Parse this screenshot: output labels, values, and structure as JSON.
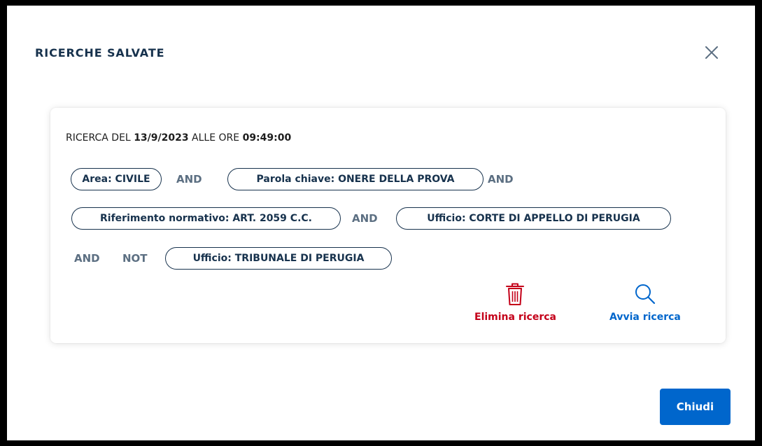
{
  "modal": {
    "title": "RICERCHE SALVATE",
    "close_icon": "close-icon"
  },
  "search": {
    "prefix": "RICERCA DEL ",
    "date": "13/9/2023",
    "middle": " ALLE ORE ",
    "time": "09:49:00",
    "criteria": [
      "Area: CIVILE",
      "Parola chiave: ONERE DELLA PROVA",
      "Riferimento normativo: ART. 2059 C.C.",
      "Ufficio: CORTE DI APPELLO DI PERUGIA",
      "Ufficio: TRIBUNALE DI PERUGIA"
    ],
    "operators": [
      "AND",
      "AND",
      "AND",
      "AND",
      "NOT"
    ]
  },
  "actions": {
    "delete_label": "Elimina ricerca",
    "delete_icon": "trash-icon",
    "run_label": "Avvia ricerca",
    "run_icon": "search-icon"
  },
  "footer": {
    "close_label": "Chiudi"
  },
  "colors": {
    "primary": "#0066cc",
    "danger": "#c40019",
    "text_dark": "#17324d",
    "operator": "#5c6f82"
  }
}
